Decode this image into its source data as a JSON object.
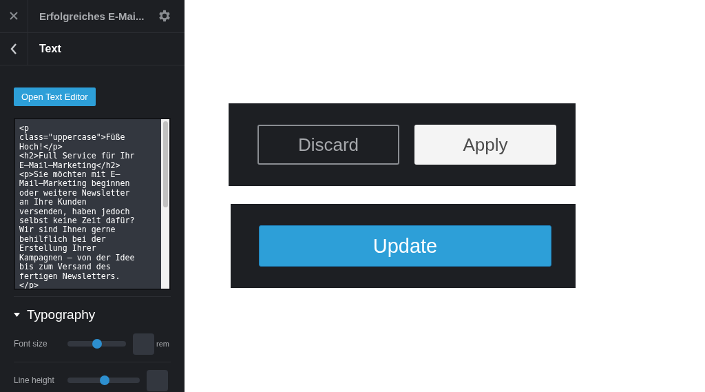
{
  "header": {
    "title": "Erfolgreiches E-Mai..."
  },
  "subheader": {
    "title": "Text"
  },
  "open_editor_button": "Open Text Editor",
  "code_lines": [
    "<p",
    "class=\"uppercase\">Füße",
    "Hoch!</p>",
    "<h2>Full Service für Ihr",
    "E–Mail–Marketing</h2>",
    "<p>Sie möchten mit E–",
    "Mail–Marketing beginnen",
    "oder weitere Newsletter",
    "an Ihre Kunden",
    "versenden, haben jedoch",
    "selbst keine Zeit dafür?",
    "Wir sind Ihnen gerne",
    "behilflich bei der",
    "Erstellung Ihrer",
    "Kampagnen – von der Idee",
    "bis zum Versand des",
    "fertigen Newsletters.",
    "</p>"
  ],
  "typography": {
    "title": "Typography",
    "expanded": true,
    "controls": [
      {
        "label": "Font size",
        "level": 0.5,
        "unit": "rem"
      },
      {
        "label": "Line height",
        "level": 0.51
      }
    ]
  },
  "action_buttons": [
    {
      "label": "Discard",
      "kind": "secondary"
    },
    {
      "label": "Apply",
      "kind": "primary"
    }
  ],
  "update_button": "Update"
}
